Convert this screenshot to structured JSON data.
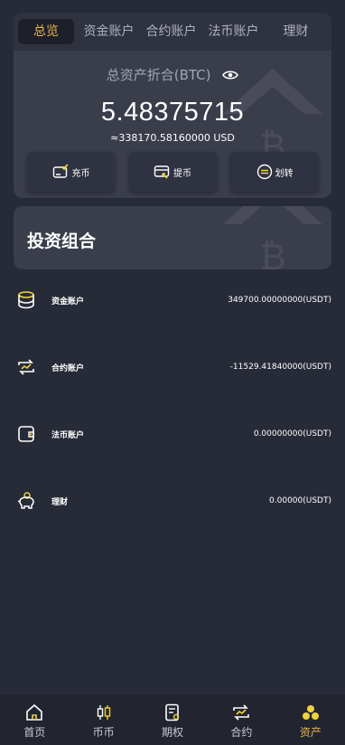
{
  "tabs": [
    {
      "label": "总览",
      "active": true
    },
    {
      "label": "资金账户",
      "active": false
    },
    {
      "label": "合约账户",
      "active": false
    },
    {
      "label": "法币账户",
      "active": false
    },
    {
      "label": "理财",
      "active": false
    }
  ],
  "summary": {
    "label": "总资产折合(BTC)",
    "btc_value": "5.48375715",
    "usd_value": "≈338170.58160000 USD",
    "actions": {
      "deposit": "充币",
      "withdraw": "提币",
      "transfer": "划转"
    }
  },
  "portfolio": {
    "title": "投资组合",
    "accounts": [
      {
        "name": "资金账户",
        "amount": "349700.00000000(USDT)",
        "icon": "database-icon"
      },
      {
        "name": "合约账户",
        "amount": "-11529.41840000(USDT)",
        "icon": "contract-icon"
      },
      {
        "name": "法币账户",
        "amount": "0.00000000(USDT)",
        "icon": "wallet-icon"
      },
      {
        "name": "理财",
        "amount": "0.00000(USDT)",
        "icon": "piggy-bank-icon"
      }
    ]
  },
  "nav": [
    {
      "label": "首页",
      "icon": "home-icon",
      "active": false
    },
    {
      "label": "币币",
      "icon": "candlestick-icon",
      "active": false
    },
    {
      "label": "期权",
      "icon": "document-icon",
      "active": false
    },
    {
      "label": "合约",
      "icon": "contract-icon",
      "active": false
    },
    {
      "label": "资产",
      "icon": "assets-icon",
      "active": true
    }
  ],
  "colors": {
    "background": "#272b37",
    "card": "#3a3d4a",
    "accent": "#e7b54a",
    "icon_yellow": "#f0d23c"
  }
}
